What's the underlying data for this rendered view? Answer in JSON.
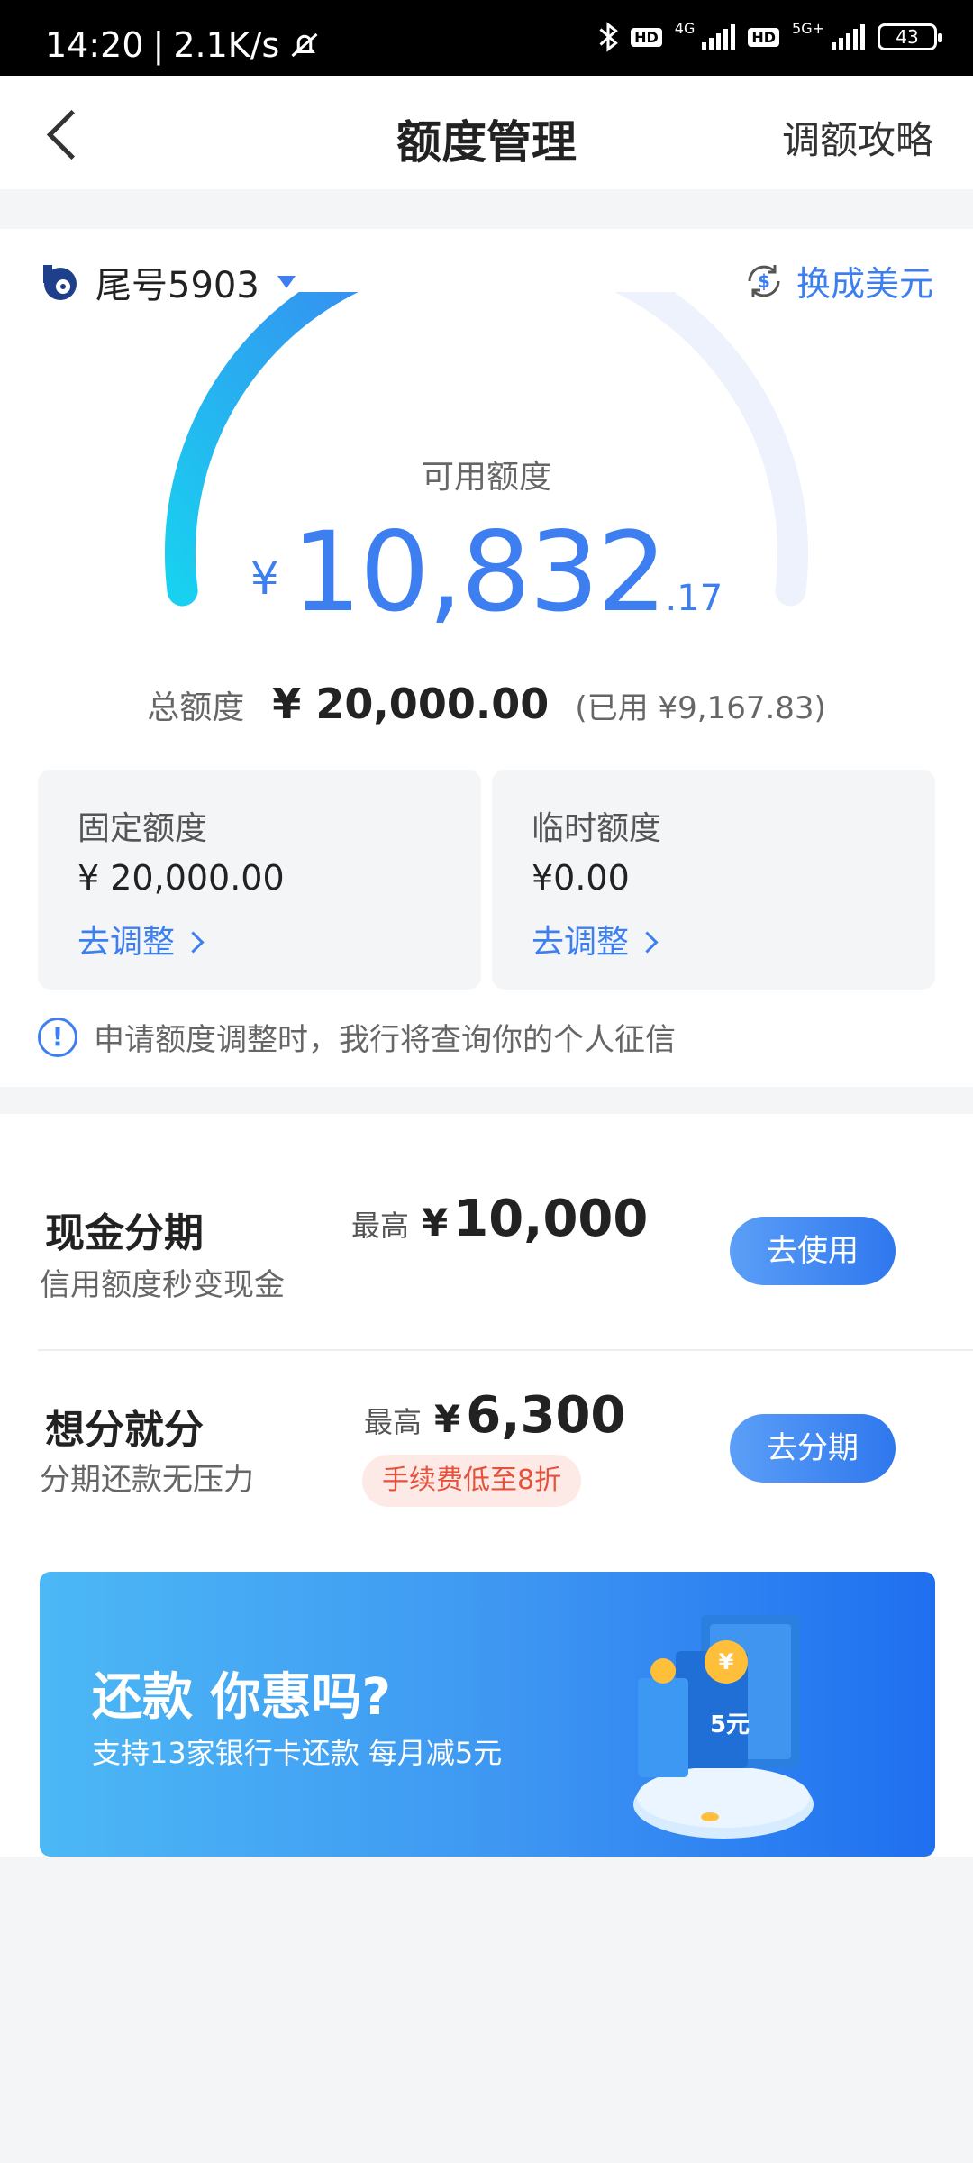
{
  "status_bar": {
    "time": "14:20",
    "speed": "2.1K/s",
    "hd": "HD",
    "net1": "4G",
    "net2": "5G+",
    "battery": "43"
  },
  "nav": {
    "title": "额度管理",
    "right_link": "调额攻略"
  },
  "account": {
    "label": "尾号5903",
    "swap_label": "换成美元"
  },
  "gauge": {
    "used_fraction": 0.458,
    "track_color": "#eef2fc",
    "fill_color_start": "#19d0f0",
    "fill_color_end": "#3d7ff0"
  },
  "available": {
    "label": "可用额度",
    "currency": "¥",
    "integer": "10,832",
    "decimal": ".17"
  },
  "total": {
    "label": "总额度",
    "amount": "¥ 20,000.00",
    "used": "(已用 ¥9,167.83)"
  },
  "quotas": [
    {
      "label": "固定额度",
      "value": "¥ 20,000.00",
      "link": "去调整"
    },
    {
      "label": "临时额度",
      "value": "¥0.00",
      "link": "去调整"
    }
  ],
  "notice": "申请额度调整时，我行将查询你的个人征信",
  "products": [
    {
      "title": "现金分期",
      "subtitle": "信用额度秒变现金",
      "max_label": "最高",
      "currency": "¥",
      "amount": "10,000",
      "button": "去使用"
    },
    {
      "title": "想分就分",
      "subtitle": "分期还款无压力",
      "max_label": "最高",
      "currency": "¥",
      "amount": "6,300",
      "button": "去分期",
      "tag": "手续费低至8折"
    }
  ],
  "banner": {
    "title": "还款 你惠吗?",
    "subtitle": "支持13家银行卡还款 每月减5元",
    "art_text": "5元"
  },
  "colors": {
    "accent": "#3d7ff0",
    "warn": "#e5523c"
  }
}
